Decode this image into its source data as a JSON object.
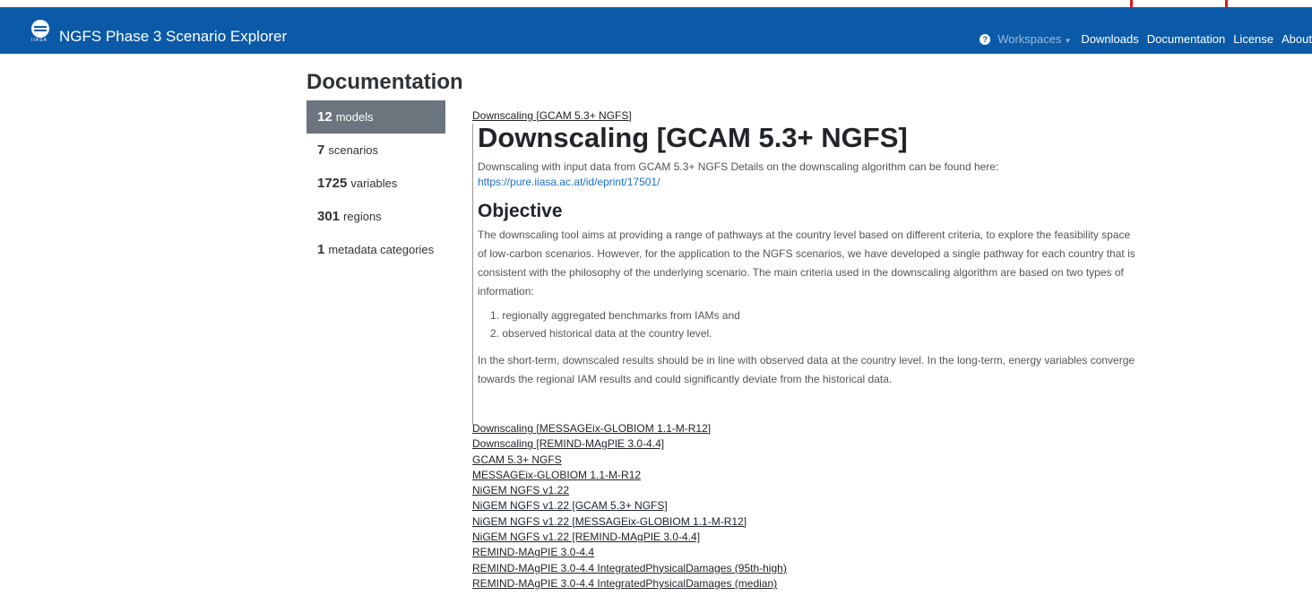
{
  "header": {
    "app_title": "NGFS Phase 3 Scenario Explorer",
    "logo_tag": "IIASA",
    "help_icon": "question-circle-icon",
    "nav": {
      "workspaces": "Workspaces",
      "downloads": "Downloads",
      "documentation": "Documentation",
      "license": "License",
      "about": "About"
    },
    "colors": {
      "bar": "#0b5aa8",
      "inactive_nav": "#9cb8dc",
      "markers": "#e0191b"
    }
  },
  "page": {
    "title": "Documentation"
  },
  "sidebar": {
    "items": [
      {
        "count": "12",
        "label": "models",
        "active": true
      },
      {
        "count": "7",
        "label": "scenarios",
        "active": false
      },
      {
        "count": "1725",
        "label": "variables",
        "active": false
      },
      {
        "count": "301",
        "label": "regions",
        "active": false
      },
      {
        "count": "1",
        "label": "metadata categories",
        "active": false
      }
    ]
  },
  "main": {
    "breadcrumb": "Downscaling [GCAM 5.3+ NGFS]",
    "heading": "Downscaling [GCAM 5.3+ NGFS]",
    "description": "Downscaling with input data from GCAM 5.3+ NGFS Details on the downscaling algorithm can be found here:",
    "description_link": "https://pure.iiasa.ac.at/id/eprint/17501/",
    "objective_heading": "Objective",
    "objective_text": "The downscaling tool aims at providing a range of pathways at the country level based on different criteria, to explore the feasibility space of low-carbon scenarios. However, for the application to the NGFS scenarios, we have developed a single pathway for each country that is consistent with the philosophy of the underlying scenario. The main criteria used in the downscaling algorithm are based on two types of information:",
    "objective_list": [
      "regionally aggregated benchmarks from IAMs and",
      "observed historical data at the country level."
    ],
    "closing_text": "In the short-term, downscaled results should be in line with observed data at the country level. In the long-term, energy variables converge towards the regional IAM results and could significantly deviate from the historical data."
  },
  "model_links": [
    "Downscaling [MESSAGEix-GLOBIOM 1.1-M-R12]",
    "Downscaling [REMIND-MAgPIE 3.0-4.4]",
    "GCAM 5.3+ NGFS",
    "MESSAGEix-GLOBIOM 1.1-M-R12",
    "NiGEM NGFS v1.22",
    "NiGEM NGFS v1.22 [GCAM 5.3+ NGFS]",
    "NiGEM NGFS v1.22 [MESSAGEix-GLOBIOM 1.1-M-R12]",
    "NiGEM NGFS v1.22 [REMIND-MAgPIE 3.0-4.4]",
    "REMIND-MAgPIE 3.0-4.4",
    "REMIND-MAgPIE 3.0-4.4 IntegratedPhysicalDamages (95th-high)",
    "REMIND-MAgPIE 3.0-4.4 IntegratedPhysicalDamages (median)"
  ]
}
